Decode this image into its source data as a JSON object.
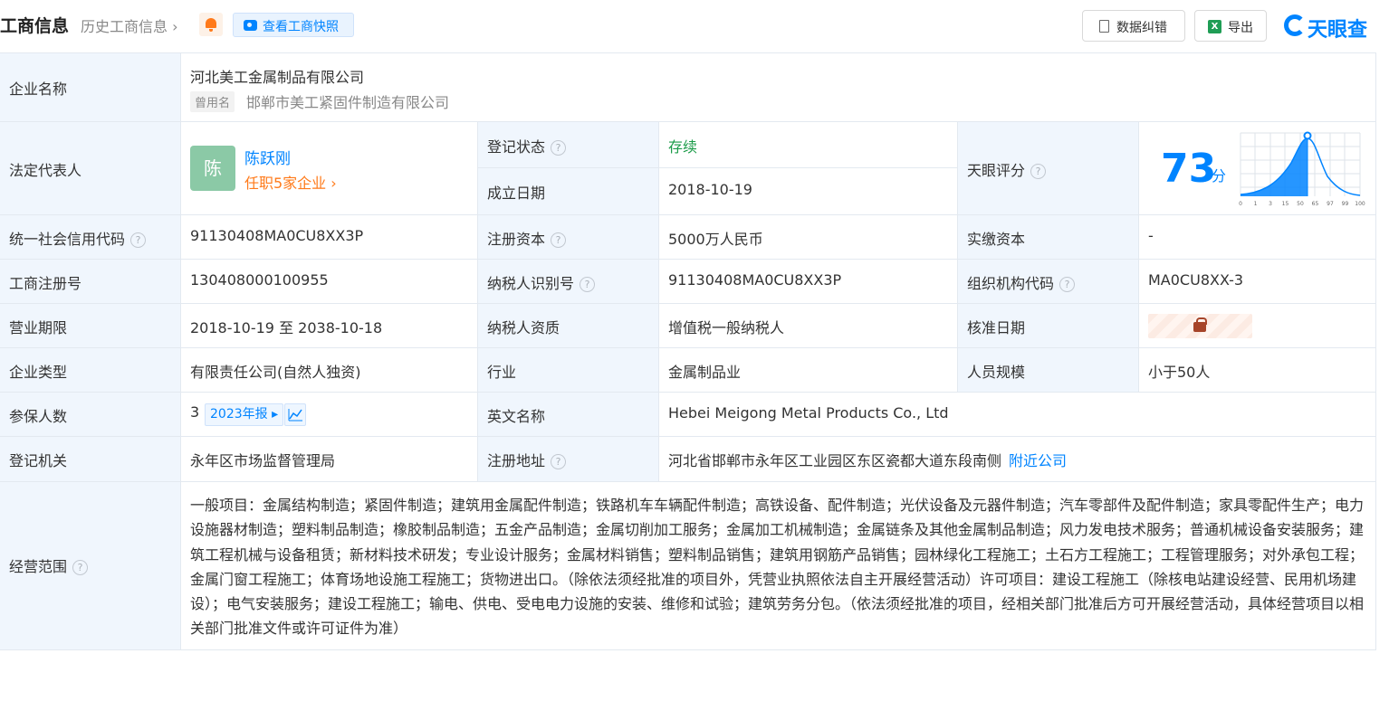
{
  "header": {
    "title": "工商信息",
    "history": "历史工商信息",
    "snapshot_btn": "查看工商快照",
    "correct_btn": "数据纠错",
    "export_btn": "导出",
    "brand": "天眼查",
    "export_icon_text": "X"
  },
  "rows": {
    "company_name_label": "企业名称",
    "company_name": "河北美工金属制品有限公司",
    "former_name_tag": "曾用名",
    "former_name": "邯郸市美工紧固件制造有限公司",
    "legal_rep_label": "法定代表人",
    "legal_rep_avatar": "陈",
    "legal_rep_name": "陈跃刚",
    "legal_rep_jobs": "任职5家企业",
    "reg_status_label": "登记状态",
    "reg_status": "存续",
    "est_date_label": "成立日期",
    "est_date": "2018-10-19",
    "score_label": "天眼评分",
    "score": "73",
    "score_unit": "分",
    "credit_code_label": "统一社会信用代码",
    "credit_code": "91130408MA0CU8XX3P",
    "reg_capital_label": "注册资本",
    "reg_capital": "5000万人民币",
    "paid_capital_label": "实缴资本",
    "paid_capital": "-",
    "biz_reg_no_label": "工商注册号",
    "biz_reg_no": "130408000100955",
    "taxpayer_id_label": "纳税人识别号",
    "taxpayer_id": "91130408MA0CU8XX3P",
    "org_code_label": "组织机构代码",
    "org_code": "MA0CU8XX-3",
    "term_label": "营业期限",
    "term": "2018-10-19 至 2038-10-18",
    "tax_qual_label": "纳税人资质",
    "tax_qual": "增值税一般纳税人",
    "approve_date_label": "核准日期",
    "type_label": "企业类型",
    "type": "有限责任公司(自然人独资)",
    "industry_label": "行业",
    "industry": "金属制品业",
    "staff_label": "人员规模",
    "staff": "小于50人",
    "insured_label": "参保人数",
    "insured": "3",
    "insured_report": "2023年报",
    "en_name_label": "英文名称",
    "en_name": "Hebei Meigong Metal Products Co., Ltd",
    "authority_label": "登记机关",
    "authority": "永年区市场监督管理局",
    "address_label": "注册地址",
    "address": "河北省邯郸市永年区工业园区东区瓷都大道东段南侧",
    "nearby": "附近公司",
    "scope_label": "经营范围",
    "scope": "一般项目：金属结构制造；紧固件制造；建筑用金属配件制造；铁路机车车辆配件制造；高铁设备、配件制造；光伏设备及元器件制造；汽车零部件及配件制造；家具零配件生产；电力设施器材制造；塑料制品制造；橡胶制品制造；五金产品制造；金属切削加工服务；金属加工机械制造；金属链条及其他金属制品制造；风力发电技术服务；普通机械设备安装服务；建筑工程机械与设备租赁；新材料技术研发；专业设计服务；金属材料销售；塑料制品销售；建筑用钢筋产品销售；园林绿化工程施工；土石方工程施工；工程管理服务；对外承包工程；金属门窗工程施工；体育场地设施工程施工；货物进出口。（除依法须经批准的项目外，凭营业执照依法自主开展经营活动）许可项目：建设工程施工（除核电站建设经营、民用机场建设）；电气安装服务；建设工程施工；输电、供电、受电电力设施的安装、维修和试验；建筑劳务分包。（依法须经批准的项目，经相关部门批准后方可开展经营活动，具体经营项目以相关部门批准文件或许可证件为准）"
  },
  "score_chart": {
    "ticks": [
      "0",
      "1",
      "3",
      "15",
      "50",
      "65",
      "97",
      "99",
      "100"
    ]
  },
  "colors": {
    "accent": "#0084ff",
    "status_green": "#1b9b48",
    "orange": "#ff7a1a",
    "label_bg": "#f0f6fd"
  }
}
